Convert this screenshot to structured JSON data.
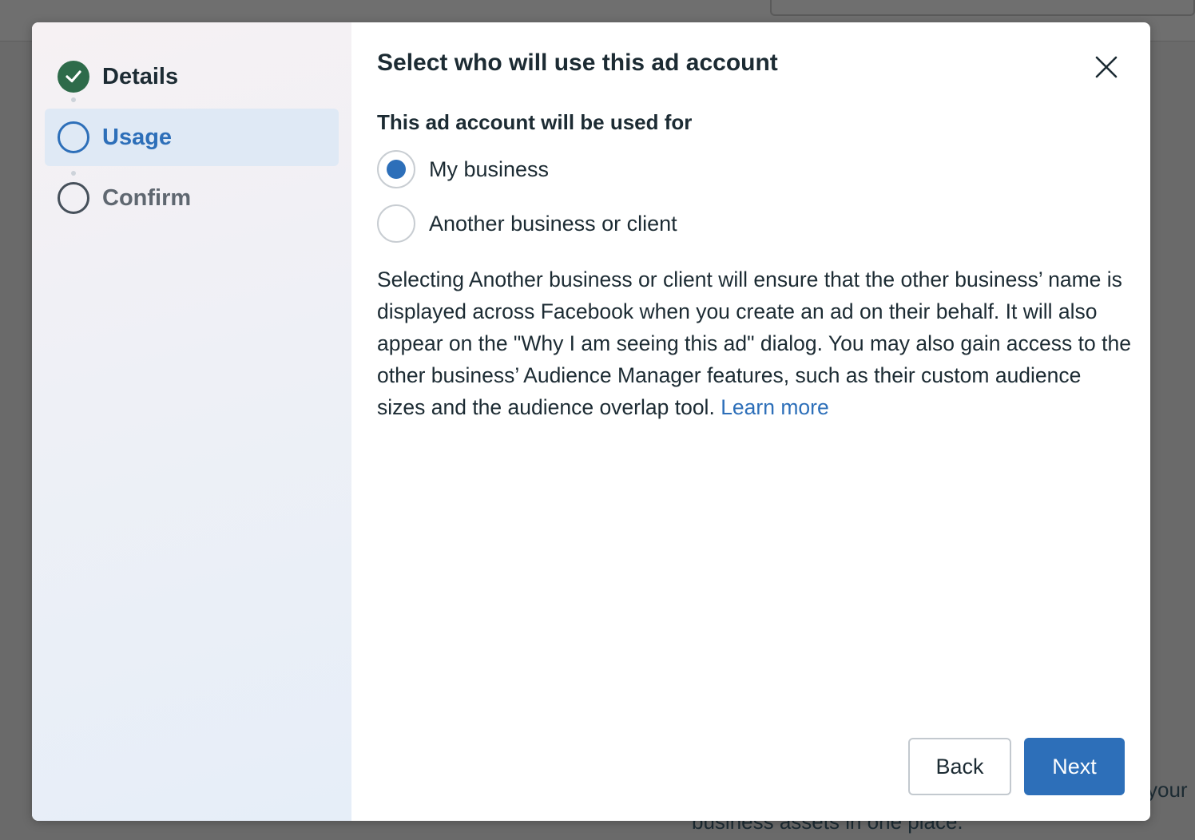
{
  "background": {
    "text_line_1": "your",
    "text_line_2": "business assets in one place."
  },
  "stepper": {
    "steps": [
      {
        "label": "Details",
        "state": "completed",
        "icon": "check-icon"
      },
      {
        "label": "Usage",
        "state": "current",
        "icon": "circle-icon"
      },
      {
        "label": "Confirm",
        "state": "pending",
        "icon": "circle-icon"
      }
    ]
  },
  "dialog": {
    "title": "Select who will use this ad account",
    "close_icon": "close-icon",
    "section_label": "This ad account will be used for",
    "options": [
      {
        "label": "My business",
        "selected": true
      },
      {
        "label": "Another business or client",
        "selected": false
      }
    ],
    "description": "Selecting Another business or client will ensure that the other business’ name is displayed across Facebook when you create an ad on their behalf. It will also appear on the \"Why I am seeing this ad\" dialog. You may also gain access to the other business’ Audience Manager features, such as their custom audience sizes and the audience overlap tool.",
    "learn_more": "Learn more",
    "back_label": "Back",
    "next_label": "Next"
  },
  "colors": {
    "accent": "#2d6fb9",
    "success": "#2e6b4a",
    "text": "#1c2b33"
  }
}
